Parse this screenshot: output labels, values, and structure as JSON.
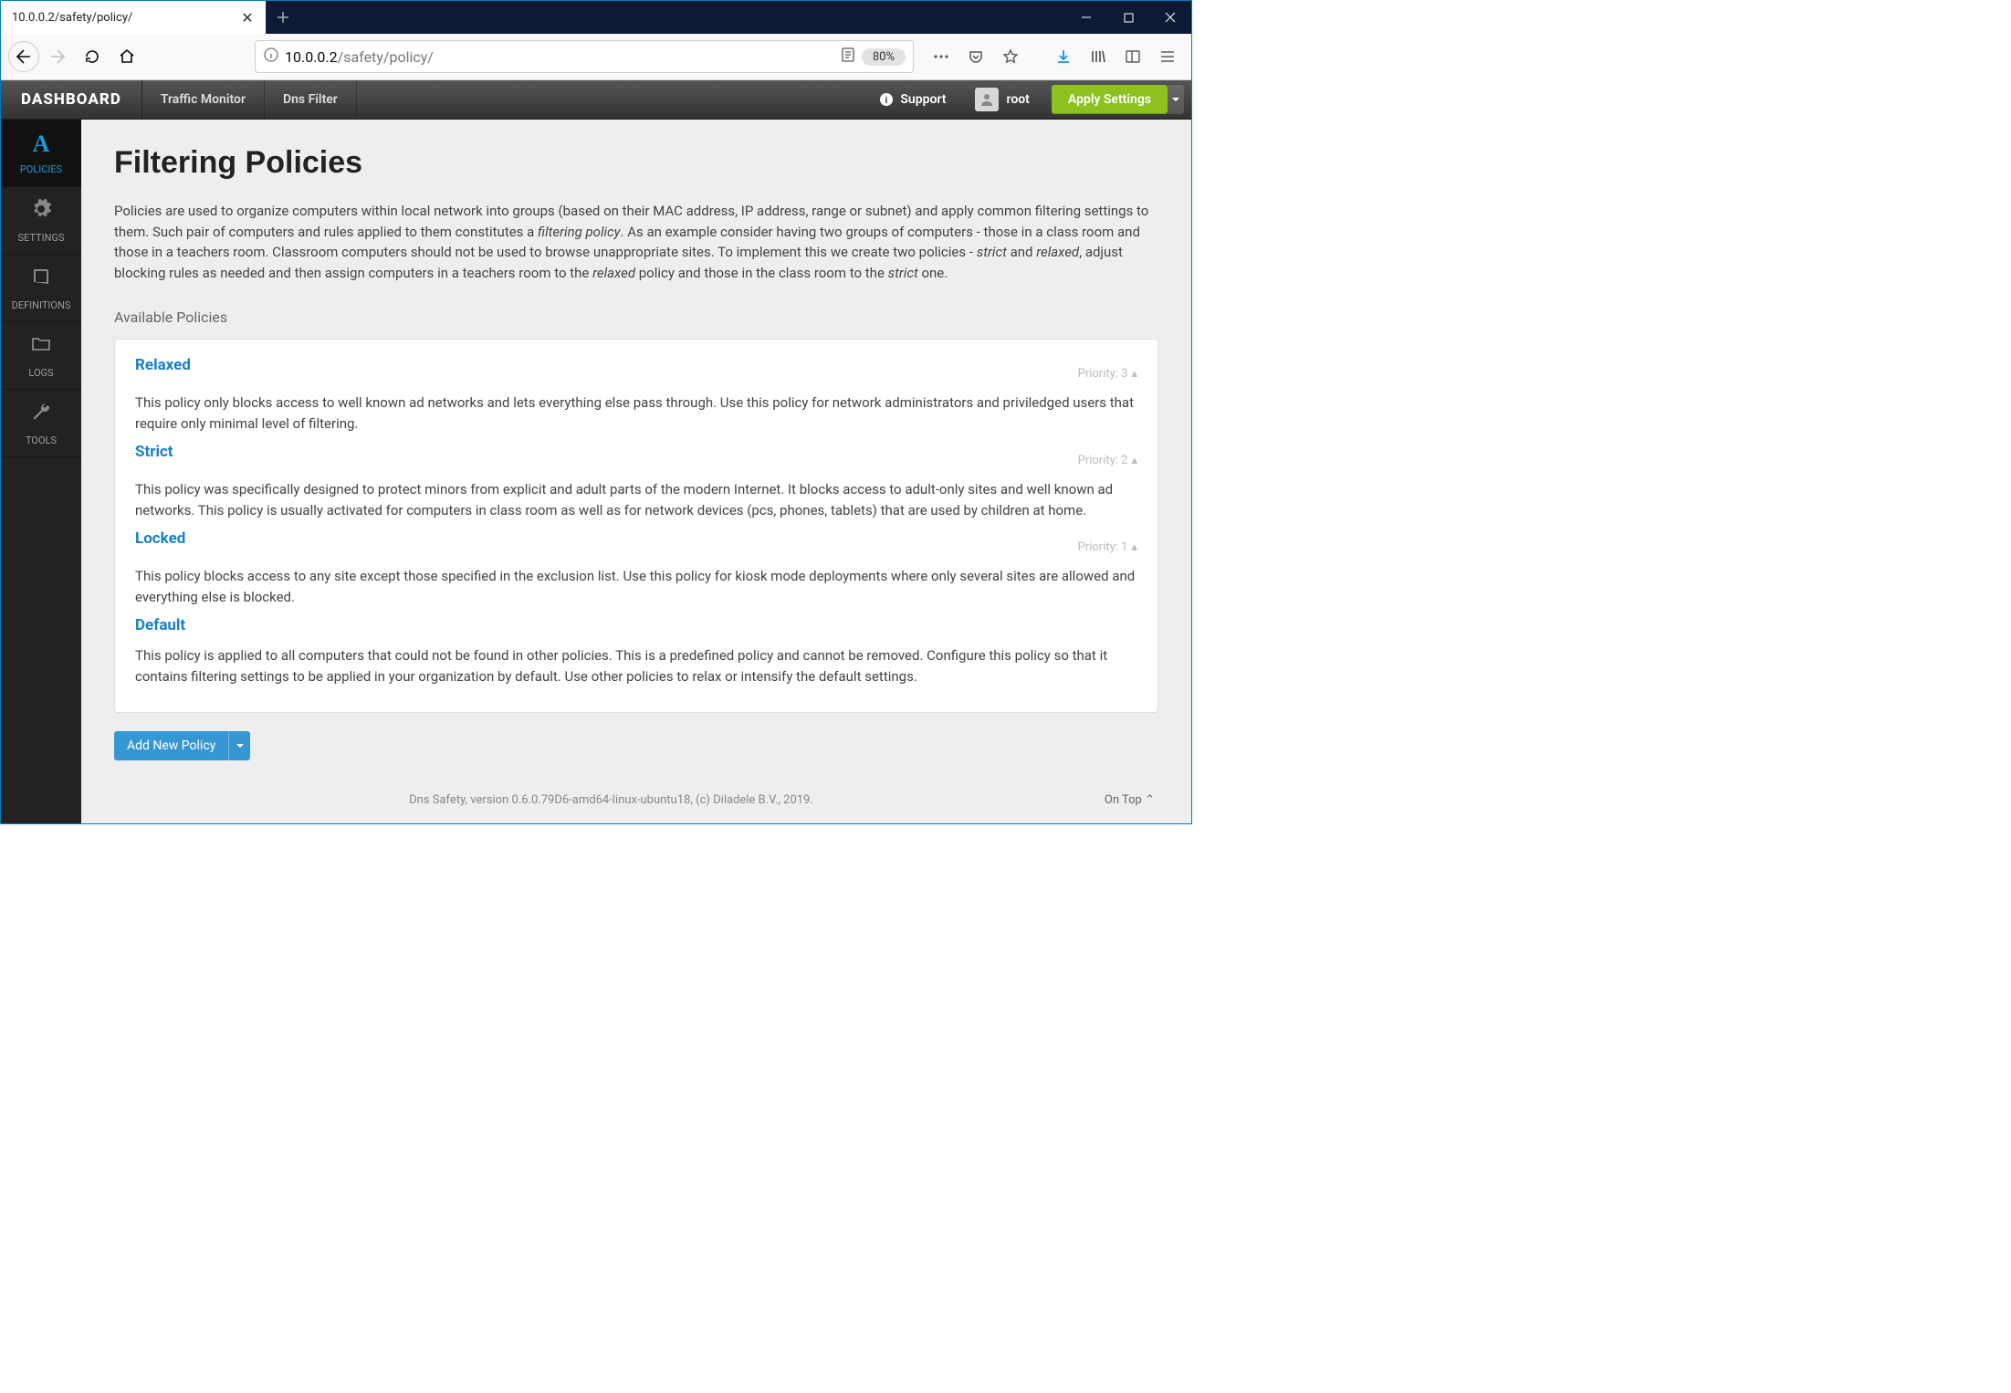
{
  "browser": {
    "tab_title": "10.0.0.2/safety/policy/",
    "url_host": "10.0.0.2",
    "url_path": "/safety/policy/",
    "zoom": "80%"
  },
  "header": {
    "brand": "DASHBOARD",
    "nav": [
      "Traffic Monitor",
      "Dns Filter"
    ],
    "support": "Support",
    "user": "root",
    "apply": "Apply Settings"
  },
  "sidebar": [
    {
      "label": "POLICIES",
      "icon": "A"
    },
    {
      "label": "SETTINGS",
      "icon": "gear"
    },
    {
      "label": "DEFINITIONS",
      "icon": "book"
    },
    {
      "label": "LOGS",
      "icon": "folder"
    },
    {
      "label": "TOOLS",
      "icon": "wrench"
    }
  ],
  "page": {
    "title": "Filtering Policies",
    "intro_1": "Policies are used to organize computers within local network into groups (based on their MAC address, IP address, range or subnet) and apply common filtering settings to them. Such pair of computers and rules applied to them constitutes a ",
    "intro_em1": "filtering policy",
    "intro_2": ". As an example consider having two groups of computers - those in a class room and those in a teachers room. Classroom computers should not be used to browse unappropriate sites. To implement this we create two policies - ",
    "intro_em2": "strict",
    "intro_3": " and ",
    "intro_em3": "relaxed",
    "intro_4": ", adjust blocking rules as needed and then assign computers in a teachers room to the ",
    "intro_em4": "relaxed",
    "intro_5": " policy and those in the class room to the ",
    "intro_em5": "strict",
    "intro_6": " one.",
    "section": "Available Policies",
    "policies": [
      {
        "name": "Relaxed",
        "priority": "Priority: 3",
        "desc": "This policy only blocks access to well known ad networks and lets everything else pass through. Use this policy for network administrators and priviledged users that require only minimal level of filtering."
      },
      {
        "name": "Strict",
        "priority": "Priority: 2",
        "desc": "This policy was specifically designed to protect minors from explicit and adult parts of the modern Internet. It blocks access to adult-only sites and well known ad networks. This policy is usually activated for computers in class room as well as for network devices (pcs, phones, tablets) that are used by children at home."
      },
      {
        "name": "Locked",
        "priority": "Priority: 1",
        "desc": "This policy blocks access to any site except those specified in the exclusion list. Use this policy for kiosk mode deployments where only several sites are allowed and everything else is blocked."
      },
      {
        "name": "Default",
        "priority": "",
        "desc": "This policy is applied to all computers that could not be found in other policies. This is a predefined policy and cannot be removed. Configure this policy so that it contains filtering settings to be applied in your organization by default. Use other policies to relax or intensify the default settings."
      }
    ],
    "add_button": "Add New Policy",
    "footer": "Dns Safety, version 0.6.0.79D6-amd64-linux-ubuntu18, (c) Diladele B.V., 2019.",
    "ontop": "On Top"
  }
}
